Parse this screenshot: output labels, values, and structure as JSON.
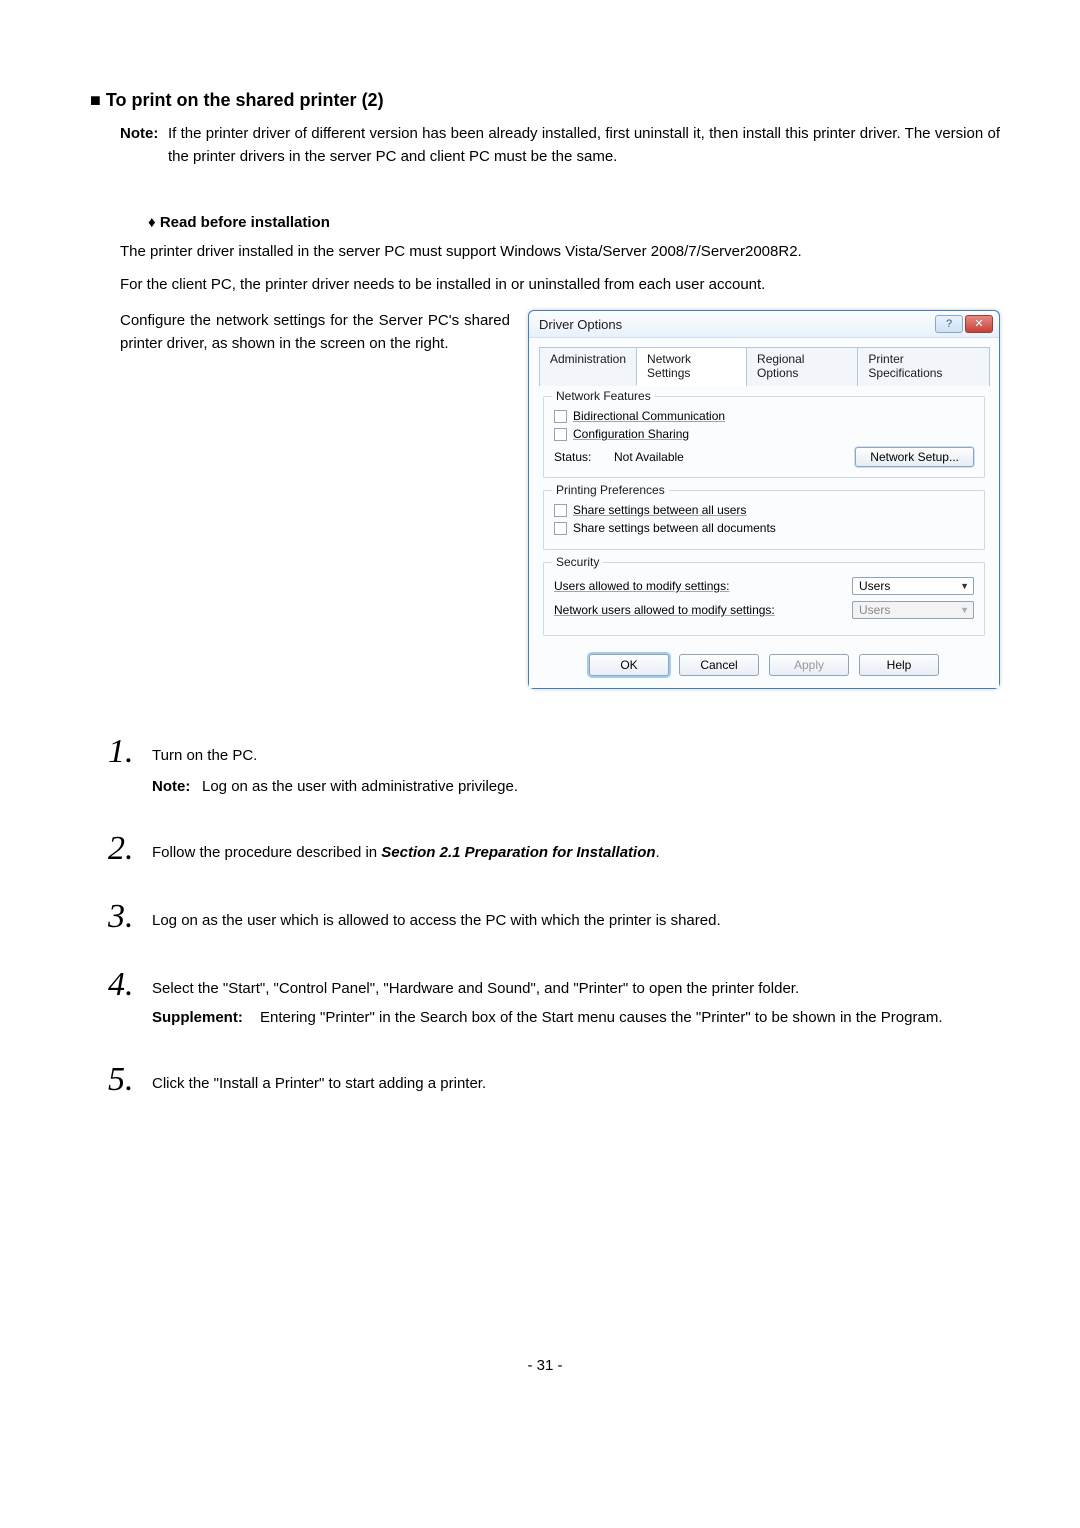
{
  "section": {
    "bullet": "■",
    "title": "To print on the shared printer (2)"
  },
  "note": {
    "label": "Note:",
    "text": "If the printer driver of different version has been already installed, first uninstall it, then install this printer driver. The version of the printer drivers in the server PC and client PC must be the same."
  },
  "subbullet": {
    "sym": "♦",
    "text": "Read before installation"
  },
  "para1": "The printer driver installed in the server PC must support Windows Vista/Server 2008/7/Server2008R2.",
  "para2": "For the client PC, the printer driver needs to be installed in or uninstalled from each user account.",
  "configText": "Configure the network settings for the Server PC's shared printer driver, as shown in the screen on the right.",
  "dialog": {
    "title": "Driver Options",
    "help": "?",
    "close": "✕",
    "tabs": [
      "Administration",
      "Network Settings",
      "Regional Options",
      "Printer Specifications"
    ],
    "activeTab": 1,
    "groups": {
      "netfeat": {
        "legend": "Network Features",
        "bidir": "Bidirectional Communication",
        "confshare": "Configuration Sharing",
        "statusLabel": "Status:",
        "statusVal": "Not Available",
        "netSetupBtn": "Network Setup..."
      },
      "prefs": {
        "legend": "Printing Preferences",
        "shareUsers": "Share settings between all users",
        "shareDocs": "Share settings between all documents"
      },
      "security": {
        "legend": "Security",
        "row1": "Users allowed to modify settings:",
        "row1val": "Users",
        "row2": "Network users allowed to modify settings:",
        "row2val": "Users"
      }
    },
    "buttons": {
      "ok": "OK",
      "cancel": "Cancel",
      "apply": "Apply",
      "help": "Help"
    }
  },
  "steps": [
    {
      "num": "1.",
      "text": "Turn on the PC.",
      "note": {
        "label": "Note:",
        "text": "Log on as the user with administrative privilege."
      }
    },
    {
      "num": "2.",
      "prefix": "Follow the procedure described in ",
      "ref": "Section 2.1 Preparation for Installation",
      "suffix": "."
    },
    {
      "num": "3.",
      "text": "Log on as the user which is allowed to access the PC with which the printer is shared."
    },
    {
      "num": "4.",
      "text": "Select the \"Start\", \"Control Panel\", \"Hardware and Sound\", and \"Printer\" to open the printer folder.",
      "supp": {
        "label": "Supplement:",
        "text": "Entering \"Printer\" in the Search box of the Start menu causes the \"Printer\" to be shown in the Program."
      }
    },
    {
      "num": "5.",
      "text": "Click the \"Install a Printer\" to start adding a printer."
    }
  ],
  "pageNumber": "- 31 -"
}
